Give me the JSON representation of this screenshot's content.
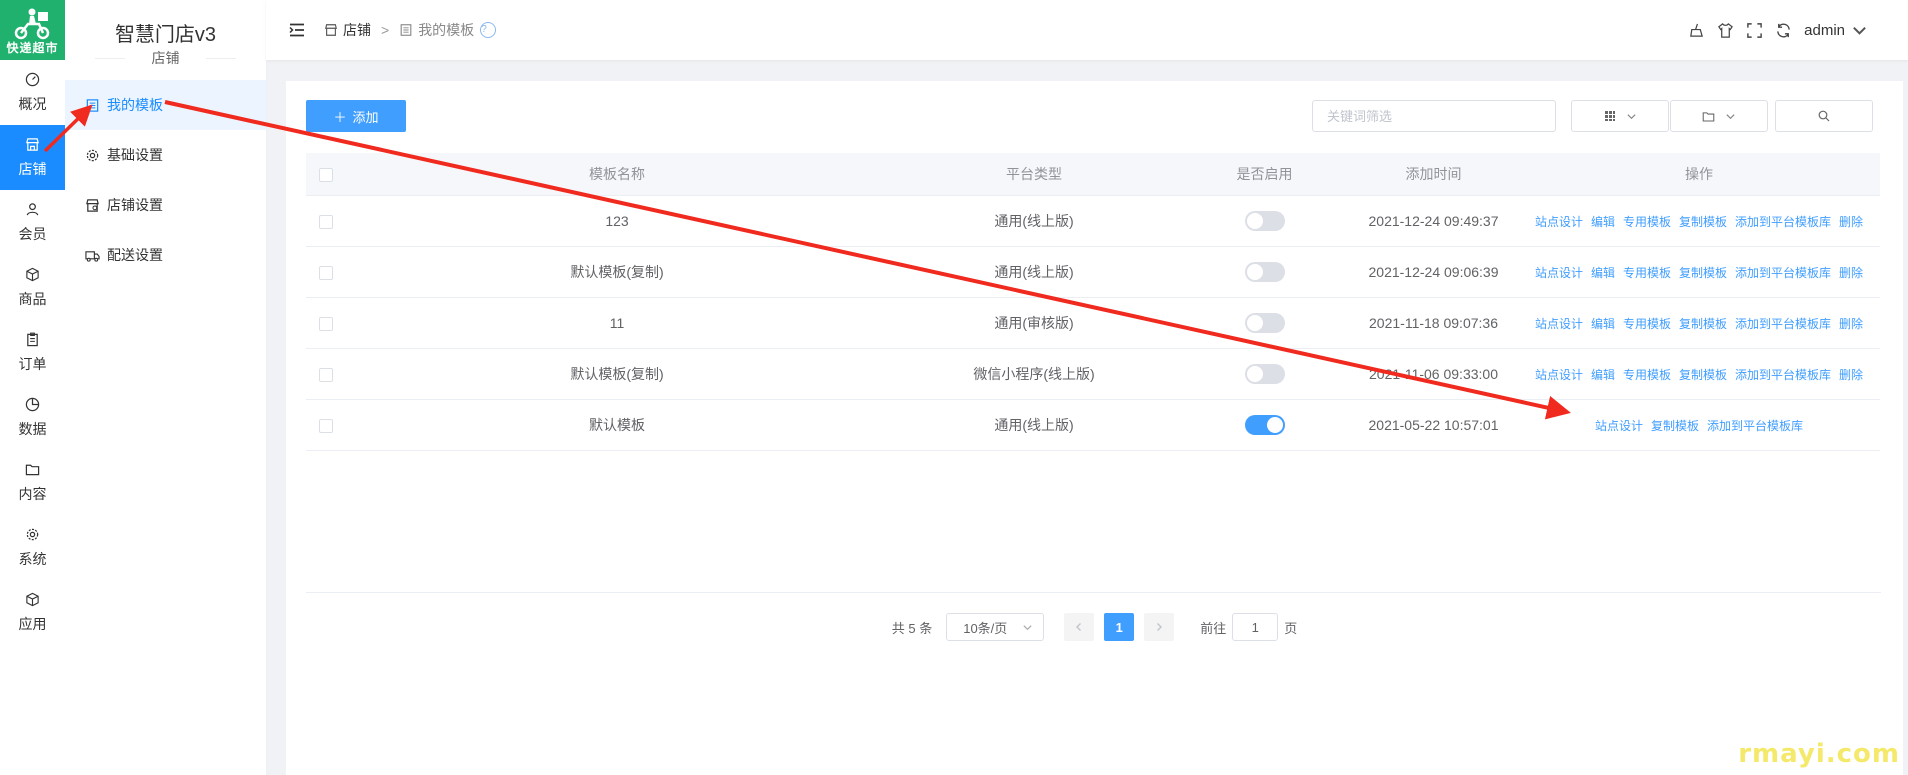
{
  "logo": {
    "text": "快递超市"
  },
  "rail": {
    "items": [
      {
        "label": "概况",
        "icon": "dashboard-icon"
      },
      {
        "label": "店铺",
        "icon": "store-icon",
        "active": true
      },
      {
        "label": "会员",
        "icon": "user-icon"
      },
      {
        "label": "商品",
        "icon": "box-icon"
      },
      {
        "label": "订单",
        "icon": "clipboard-icon"
      },
      {
        "label": "数据",
        "icon": "pie-chart-icon"
      },
      {
        "label": "内容",
        "icon": "folder-icon"
      },
      {
        "label": "系统",
        "icon": "gear-icon"
      },
      {
        "label": "应用",
        "icon": "cube-icon"
      }
    ]
  },
  "subnav": {
    "app_title": "智慧门店v3",
    "section": "店铺",
    "items": [
      {
        "label": "我的模板",
        "icon": "template-list-icon",
        "active": true
      },
      {
        "label": "基础设置",
        "icon": "gear-icon"
      },
      {
        "label": "店铺设置",
        "icon": "shop-settings-icon"
      },
      {
        "label": "配送设置",
        "icon": "truck-icon"
      }
    ]
  },
  "header": {
    "breadcrumb": [
      "店铺",
      "我的模板"
    ],
    "separator": ">",
    "help": "?",
    "user": "admin"
  },
  "toolbar": {
    "add_label": "添加",
    "search_placeholder": "关键词筛选"
  },
  "table": {
    "columns": [
      "模板名称",
      "平台类型",
      "是否启用",
      "添加时间",
      "操作"
    ],
    "rows": [
      {
        "name": "123",
        "platform": "通用(线上版)",
        "enabled": false,
        "time": "2021-12-24 09:49:37",
        "ops": [
          "站点设计",
          "编辑",
          "专用模板",
          "复制模板",
          "添加到平台模板库",
          "删除"
        ]
      },
      {
        "name": "默认模板(复制)",
        "platform": "通用(线上版)",
        "enabled": false,
        "time": "2021-12-24 09:06:39",
        "ops": [
          "站点设计",
          "编辑",
          "专用模板",
          "复制模板",
          "添加到平台模板库",
          "删除"
        ]
      },
      {
        "name": "11",
        "platform": "通用(审核版)",
        "enabled": false,
        "time": "2021-11-18 09:07:36",
        "ops": [
          "站点设计",
          "编辑",
          "专用模板",
          "复制模板",
          "添加到平台模板库",
          "删除"
        ]
      },
      {
        "name": "默认模板(复制)",
        "platform": "微信小程序(线上版)",
        "enabled": false,
        "time": "2021-11-06 09:33:00",
        "ops": [
          "站点设计",
          "编辑",
          "专用模板",
          "复制模板",
          "添加到平台模板库",
          "删除"
        ]
      },
      {
        "name": "默认模板",
        "platform": "通用(线上版)",
        "enabled": true,
        "time": "2021-05-22 10:57:01",
        "ops": [
          "站点设计",
          "复制模板",
          "添加到平台模板库"
        ]
      }
    ]
  },
  "pagination": {
    "total_text": "共 5 条",
    "page_size": "10条/页",
    "current_page": "1",
    "goto_prefix": "前往",
    "goto_value": "1",
    "goto_suffix": "页"
  },
  "watermark": "rmayi.com",
  "colors": {
    "accent": "#409eff",
    "rail_active": "#1a8cff",
    "logo_bg": "#1fb16d",
    "arrow": "#f02a1e"
  }
}
